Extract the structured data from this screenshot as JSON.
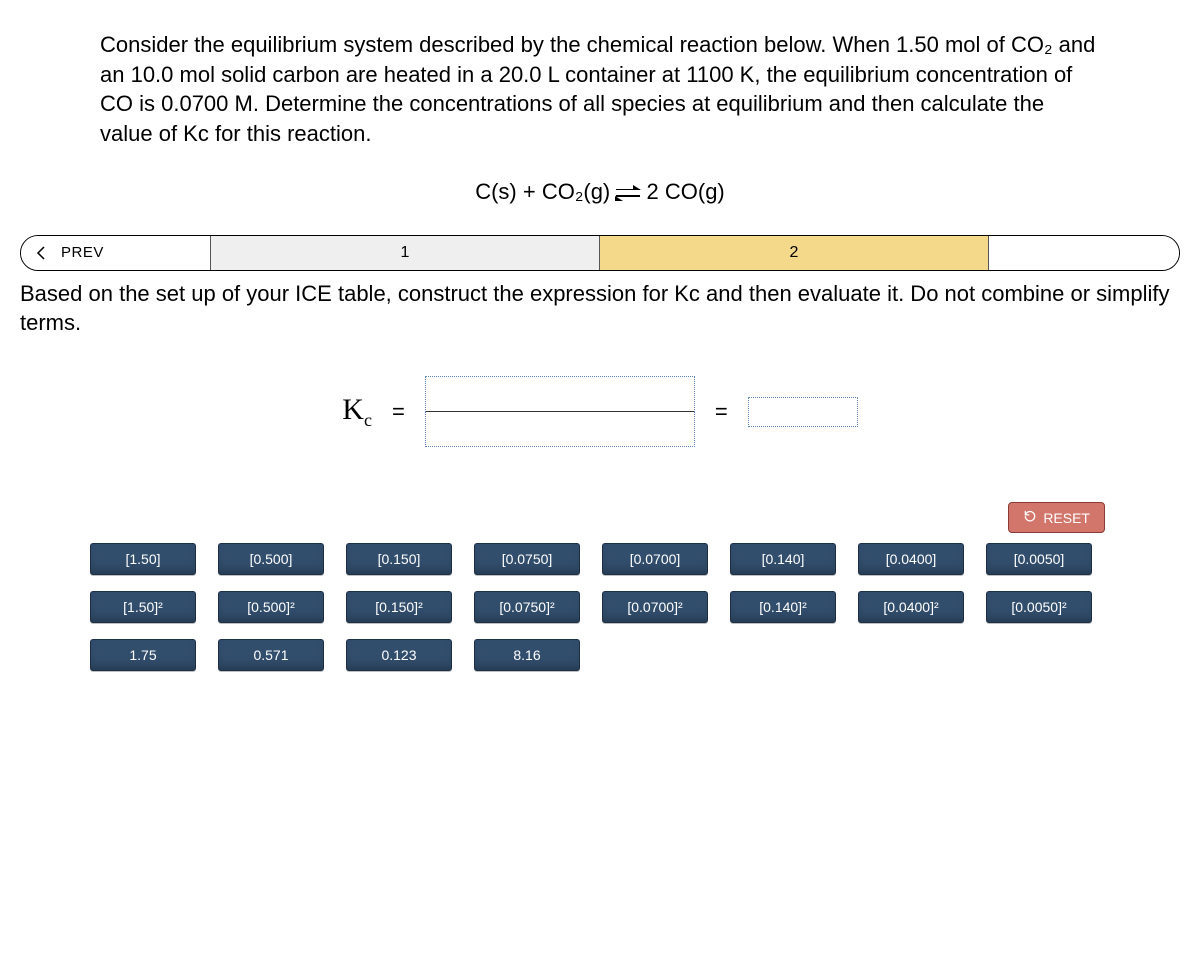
{
  "problem_text": "Consider the equilibrium system described by the chemical reaction below. When 1.50 mol of CO₂ and an 10.0 mol solid carbon are heated in a 20.0 L container at 1100 K, the equilibrium concentration of CO is 0.0700 M. Determine the concentrations of all species at equilibrium and then calculate the value of Kc for this reaction.",
  "equation": {
    "left": "C(s) + CO₂(g)",
    "right": "2 CO(g)"
  },
  "nav": {
    "prev": "PREV",
    "step1": "1",
    "step2": "2"
  },
  "instruction": "Based on the set up of your ICE table, construct the expression for Kc and then evaluate it. Do not combine or simplify terms.",
  "expression": {
    "kc": "K",
    "kc_sub": "c",
    "equals": "="
  },
  "reset": "RESET",
  "tiles": {
    "row1": [
      "[1.50]",
      "[0.500]",
      "[0.150]",
      "[0.0750]",
      "[0.0700]",
      "[0.140]",
      "[0.0400]",
      "[0.0050]"
    ],
    "row2": [
      "[1.50]²",
      "[0.500]²",
      "[0.150]²",
      "[0.0750]²",
      "[0.0700]²",
      "[0.140]²",
      "[0.0400]²",
      "[0.0050]²"
    ],
    "row3": [
      "1.75",
      "0.571",
      "0.123",
      "8.16"
    ]
  }
}
